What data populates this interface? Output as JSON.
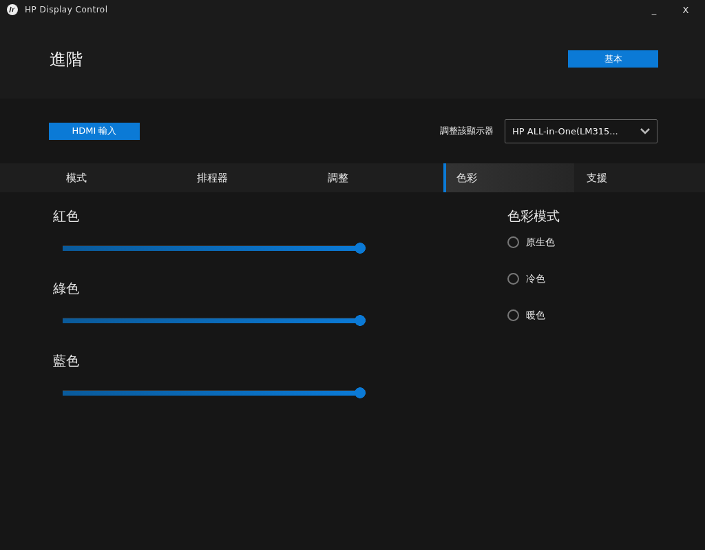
{
  "window": {
    "title": "HP Display Control",
    "minimize": "_",
    "close": "X"
  },
  "page_title": "進階",
  "basic_button": "基本",
  "input_button": "HDMI 輸入",
  "monitor_select": {
    "label": "調整該顯示器",
    "value": "HP ALL-in-One(LM315..."
  },
  "tabs": [
    {
      "label": "模式",
      "selected": false
    },
    {
      "label": "排程器",
      "selected": false
    },
    {
      "label": "調整",
      "selected": false
    },
    {
      "label": "色彩",
      "selected": true
    },
    {
      "label": "支援",
      "selected": false
    }
  ],
  "sliders": [
    {
      "label": "紅色",
      "level": 1
    },
    {
      "label": "綠色",
      "level": 1
    },
    {
      "label": "藍色",
      "level": 1
    }
  ],
  "color_mode": {
    "title": "色彩模式",
    "options": [
      {
        "label": "原生色",
        "selected": false
      },
      {
        "label": "冷色",
        "selected": false
      },
      {
        "label": "暖色",
        "selected": false
      }
    ]
  }
}
